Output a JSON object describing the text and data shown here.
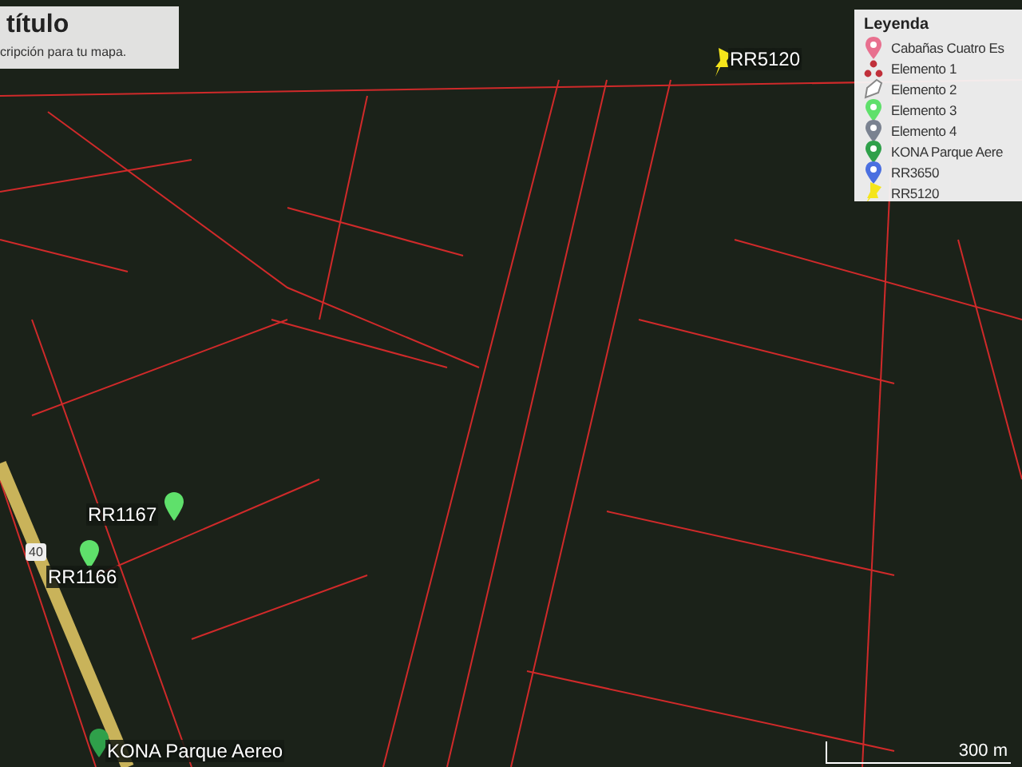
{
  "map": {
    "road_shield": "40",
    "placemarks": [
      {
        "label": "RR5120",
        "kind": "pushpin",
        "color": "#f5e51b"
      },
      {
        "label": "RR1167",
        "kind": "pin",
        "color": "#5fe06b"
      },
      {
        "label": "RR1166",
        "kind": "pin",
        "color": "#5fe06b"
      },
      {
        "label": "KONA Parque Aereo",
        "kind": "pin",
        "color": "#2fa04a"
      }
    ],
    "scale": "300 m"
  },
  "title_panel": {
    "title": "título",
    "description": "cripción para tu mapa."
  },
  "legend": {
    "title": "Leyenda",
    "items": [
      {
        "label": "Cabañas Cuatro Es",
        "kind": "pin",
        "color": "#e8708f"
      },
      {
        "label": "Elemento 1",
        "kind": "cluster",
        "color": "#c0303a"
      },
      {
        "label": "Elemento 2",
        "kind": "polygon",
        "color": "#888888"
      },
      {
        "label": "Elemento 3",
        "kind": "pin",
        "color": "#5fe06b"
      },
      {
        "label": "Elemento 4",
        "kind": "pin",
        "color": "#7a8290"
      },
      {
        "label": "KONA Parque Aere",
        "kind": "pin",
        "color": "#2fa04a"
      },
      {
        "label": "RR3650",
        "kind": "pin",
        "color": "#4a6fe0"
      },
      {
        "label": "RR5120",
        "kind": "pushpin",
        "color": "#f5e51b"
      }
    ]
  }
}
